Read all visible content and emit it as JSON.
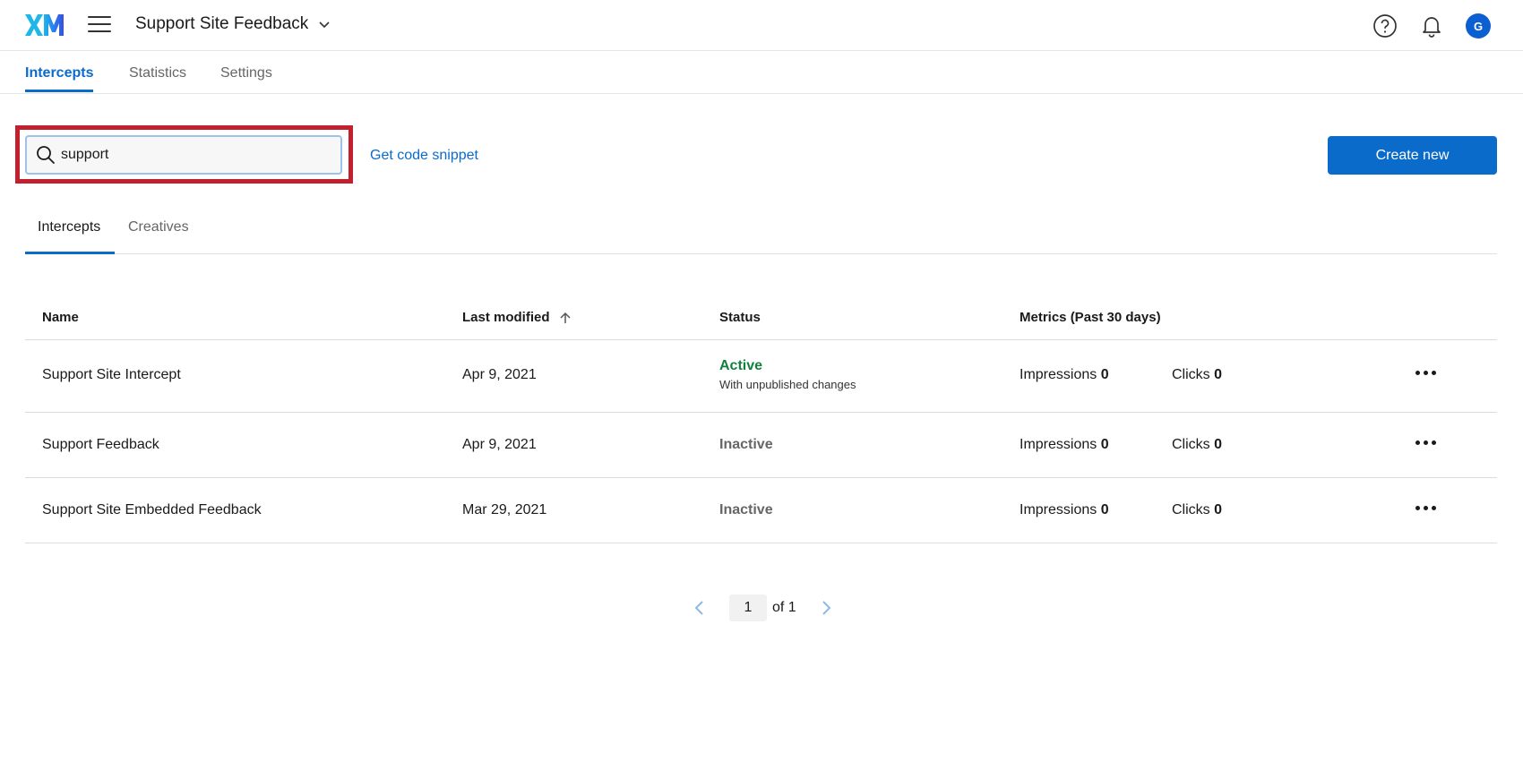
{
  "header": {
    "logo_text": "XM",
    "project_title": "Support Site Feedback",
    "avatar_initial": "G"
  },
  "main_nav": {
    "tabs": [
      {
        "label": "Intercepts",
        "active": true
      },
      {
        "label": "Statistics",
        "active": false
      },
      {
        "label": "Settings",
        "active": false
      }
    ]
  },
  "toolbar": {
    "search_value": "support",
    "code_snippet_label": "Get code snippet",
    "create_label": "Create new"
  },
  "sub_tabs": [
    {
      "label": "Intercepts",
      "active": true
    },
    {
      "label": "Creatives",
      "active": false
    }
  ],
  "table": {
    "columns": [
      "Name",
      "Last modified",
      "Status",
      "Metrics (Past 30 days)"
    ],
    "rows": [
      {
        "name": "Support Site Intercept",
        "modified": "Apr 9, 2021",
        "status": "Active",
        "status_note": "With unpublished changes",
        "impressions_label": "Impressions",
        "impressions": "0",
        "clicks_label": "Clicks",
        "clicks": "0"
      },
      {
        "name": "Support Feedback",
        "modified": "Apr 9, 2021",
        "status": "Inactive",
        "impressions_label": "Impressions",
        "impressions": "0",
        "clicks_label": "Clicks",
        "clicks": "0"
      },
      {
        "name": "Support Site Embedded Feedback",
        "modified": "Mar 29, 2021",
        "status": "Inactive",
        "impressions_label": "Impressions",
        "impressions": "0",
        "clicks_label": "Clicks",
        "clicks": "0"
      }
    ]
  },
  "pagination": {
    "current_page": "1",
    "of_text": "of 1"
  },
  "colors": {
    "accent": "#0b6bcb",
    "active_status": "#12803d",
    "highlight": "#c21f2f"
  },
  "icons": [
    "xm-logo-icon",
    "hamburger-menu-icon",
    "chevron-down-icon",
    "help-icon",
    "bell-icon",
    "search-icon",
    "sort-ascending-icon",
    "more-options-icon",
    "chevron-left-icon",
    "chevron-right-icon"
  ]
}
